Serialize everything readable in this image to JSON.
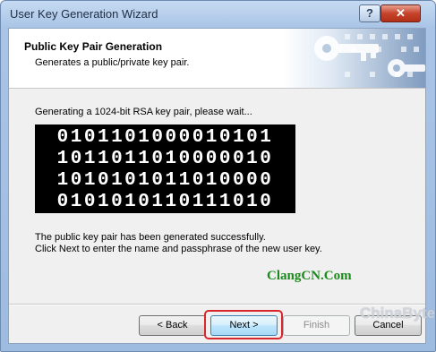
{
  "window": {
    "title": "User Key Generation Wizard",
    "help_glyph": "?",
    "close_glyph": "✕"
  },
  "header": {
    "title": "Public Key Pair Generation",
    "subtitle": "Generates a public/private key pair."
  },
  "main": {
    "status": "Generating a 1024-bit RSA key pair, please wait...",
    "binary_rows": [
      "0101101000010101",
      "1011011010000010",
      "1010101011010000",
      "0101010110111010"
    ],
    "done_line1": "The public key pair has been generated successfully.",
    "done_line2": "Click Next to enter the name and passphrase of the new user key."
  },
  "buttons": {
    "back": "< Back",
    "next": "Next >",
    "finish": "Finish",
    "cancel": "Cancel"
  },
  "watermarks": {
    "site": "ClangCN.Com",
    "logo": "ChinaByte"
  },
  "colors": {
    "titlebar": "#a9c4e6",
    "close": "#c6432c",
    "highlight": "#d9262c",
    "watermark_green": "#1a8a1a",
    "binary_bg": "#000000"
  },
  "icons": {
    "header_graphic": "key-icon"
  }
}
